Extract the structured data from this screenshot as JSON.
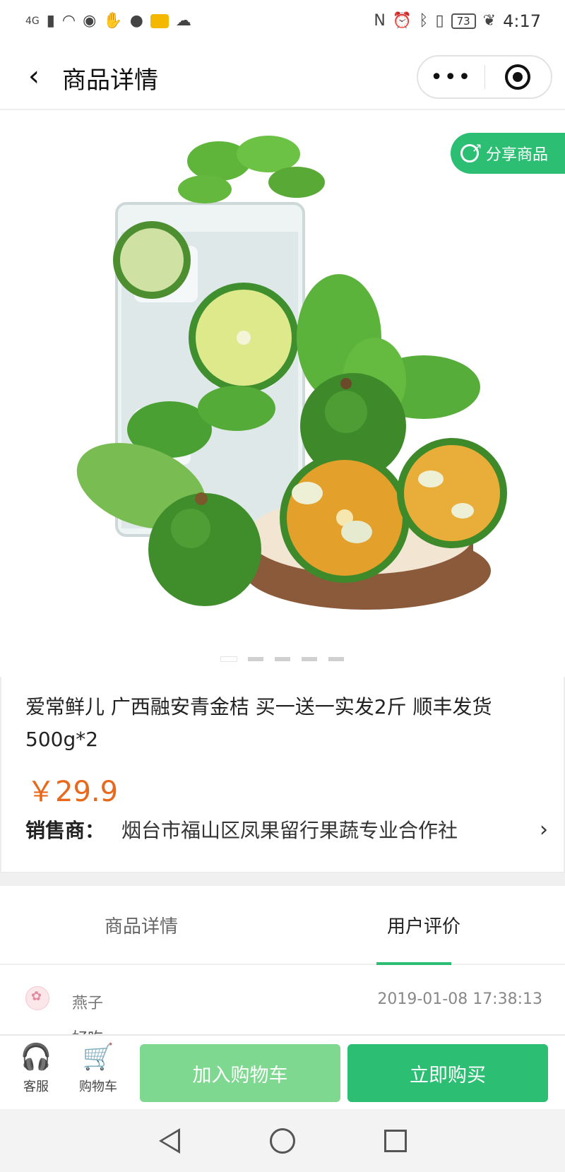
{
  "status_bar": {
    "network": "4G",
    "battery": "73",
    "time": "4:17"
  },
  "nav": {
    "title": "商品详情",
    "more_glyph": "•••"
  },
  "gallery": {
    "share_label": "分享商品",
    "image_count": 5,
    "active_index": 0
  },
  "product": {
    "title": "爱常鲜儿 广西融安青金桔 买一送一实发2斤 顺丰发货 500g*2",
    "price": "￥29.9",
    "seller_label": "销售商：",
    "seller_name": "烟台市福山区凤果留行果蔬专业合作社"
  },
  "tabs": {
    "items": [
      "商品详情",
      "用户评价"
    ],
    "active": "用户评价"
  },
  "review": {
    "user": "燕子",
    "date": "2019-01-08 17:38:13",
    "peek_text": "好吃"
  },
  "actions": {
    "service_label": "客服",
    "cart_label": "购物车",
    "add_to_cart": "加入购物车",
    "buy_now": "立即购买"
  },
  "colors": {
    "brand_green": "#2cbf74",
    "light_green": "#7ed88f",
    "price_orange": "#e8681c"
  }
}
